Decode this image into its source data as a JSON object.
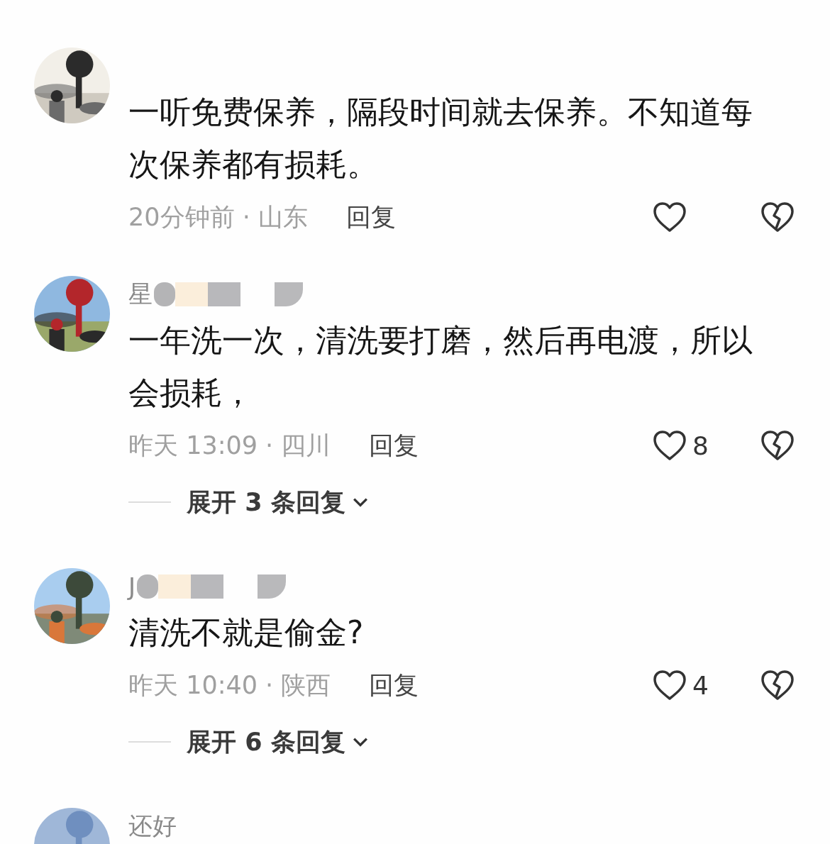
{
  "comments": [
    {
      "text": "一听免费保养，隔段时间就去保养。不知道每次保养都有损耗。",
      "time_location": "20分钟前 · 山东",
      "reply_label": "回复"
    },
    {
      "username": "星",
      "name_redacted": true,
      "text": "一年洗一次，清洗要打磨，然后再电渡，所以会损耗，",
      "time_location": "昨天 13:09 · 四川",
      "reply_label": "回复",
      "like_count": "8",
      "expand_label": "展开 3 条回复"
    },
    {
      "username": "J",
      "name_redacted": true,
      "text": "清洗不就是偷金?",
      "time_location": "昨天 10:40 · 陕西",
      "reply_label": "回复",
      "like_count": "4",
      "expand_label": "展开 6 条回复"
    },
    {
      "username": "还好"
    }
  ]
}
